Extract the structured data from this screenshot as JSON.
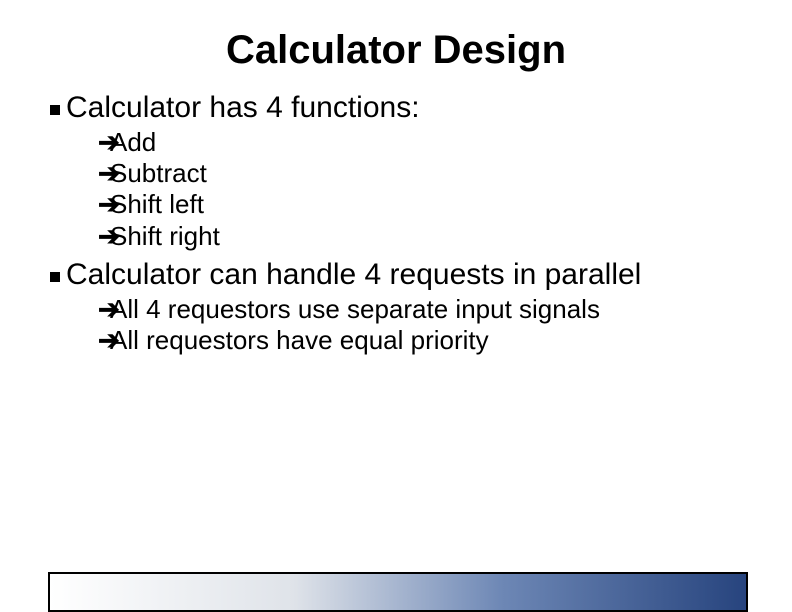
{
  "title": "Calculator Design",
  "arrow_glyph": "➔",
  "bullets": [
    {
      "text": "Calculator has 4 functions:",
      "sub": [
        {
          "text": "Add"
        },
        {
          "text": "Subtract"
        },
        {
          "text": "Shift left"
        },
        {
          "text": "Shift right"
        }
      ]
    },
    {
      "text": "Calculator can handle 4 requests in parallel",
      "sub": [
        {
          "text": "All 4 requestors use separate input signals"
        },
        {
          "text": "All requestors have equal priority"
        }
      ]
    }
  ]
}
